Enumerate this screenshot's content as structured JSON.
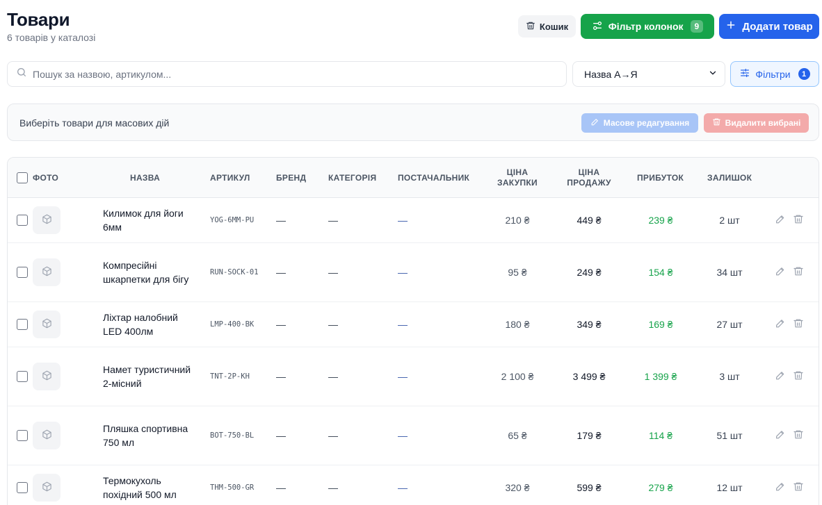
{
  "header": {
    "title": "Товари",
    "subtitle": "6 товарів у каталозі",
    "trash_label": "Кошик",
    "columns_label": "Фільтр колонок",
    "columns_count": "9",
    "add_label": "Додати товар"
  },
  "toolbar": {
    "search_placeholder": "Пошук за назвою, артикулом...",
    "search_value": "",
    "sort_selected": "Назва А→Я",
    "filters_label": "Фільтри",
    "filters_count": "1"
  },
  "bulk": {
    "hint": "Виберіть товари для масових дій",
    "edit_label": "Масове редагування",
    "delete_label": "Видалити вибрані"
  },
  "columns": {
    "photo": "ФОТО",
    "name": "НАЗВА",
    "sku": "АРТИКУЛ",
    "brand": "БРЕНД",
    "category": "КАТЕГОРІЯ",
    "supplier": "ПОСТАЧАЛЬНИК",
    "cost_line1": "ЦІНА",
    "cost_line2": "ЗАКУПКИ",
    "price_line1": "ЦІНА",
    "price_line2": "ПРОДАЖУ",
    "profit": "ПРИБУТОК",
    "stock": "ЗАЛИШОК"
  },
  "rows": [
    {
      "name": "Килимок для йоги 6мм",
      "sku": "YOG-6MM-PU",
      "brand": "—",
      "category": "—",
      "supplier": "—",
      "cost": "210 ₴",
      "price": "449 ₴",
      "profit": "239 ₴",
      "stock": "2 шт"
    },
    {
      "name": "Компресійні шкарпетки для бігу",
      "sku": "RUN-SOCK-01",
      "brand": "—",
      "category": "—",
      "supplier": "—",
      "cost": "95 ₴",
      "price": "249 ₴",
      "profit": "154 ₴",
      "stock": "34 шт"
    },
    {
      "name": "Ліхтар налобний LED 400лм",
      "sku": "LMP-400-BK",
      "brand": "—",
      "category": "—",
      "supplier": "—",
      "cost": "180 ₴",
      "price": "349 ₴",
      "profit": "169 ₴",
      "stock": "27 шт"
    },
    {
      "name": "Намет туристичний 2-місний",
      "sku": "TNT-2P-KH",
      "brand": "—",
      "category": "—",
      "supplier": "—",
      "cost": "2 100 ₴",
      "price": "3 499 ₴",
      "profit": "1 399 ₴",
      "stock": "3 шт"
    },
    {
      "name": "Пляшка спортивна 750 мл",
      "sku": "BOT-750-BL",
      "brand": "—",
      "category": "—",
      "supplier": "—",
      "cost": "65 ₴",
      "price": "179 ₴",
      "profit": "114 ₴",
      "stock": "51 шт"
    },
    {
      "name": "Термокухоль похідний 500 мл",
      "sku": "THM-500-GR",
      "brand": "—",
      "category": "—",
      "supplier": "—",
      "cost": "320 ₴",
      "price": "599 ₴",
      "profit": "279 ₴",
      "stock": "12 шт"
    }
  ],
  "colors": {
    "primary": "#2563eb",
    "success": "#16a34a",
    "danger_soft": "#f3aaaa",
    "primary_soft": "#a8c5f7"
  },
  "icons": {
    "trash": "trash-icon",
    "columns": "sliders-icon",
    "add": "plus-icon",
    "search": "search-icon",
    "sort": "chevron-down-icon",
    "filters": "filter-lines-icon",
    "edit": "pencil-icon",
    "photo_placeholder": "box-icon"
  }
}
